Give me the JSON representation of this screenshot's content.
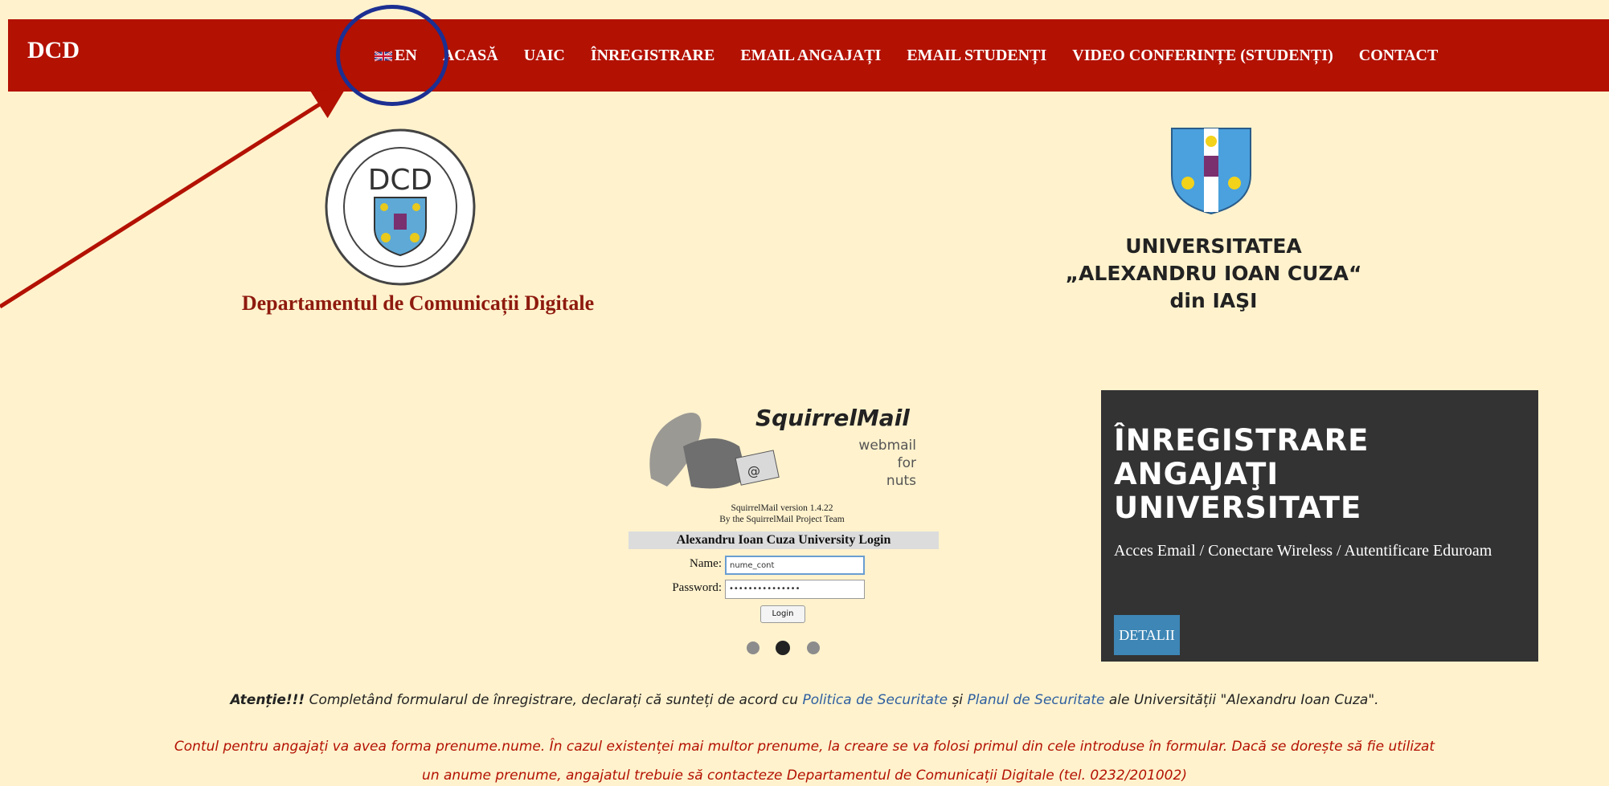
{
  "nav": {
    "brand": "DCD",
    "items": [
      {
        "label": "EN",
        "flag": "uk-flag-icon"
      },
      {
        "label": "ACASĂ"
      },
      {
        "label": "UAIC"
      },
      {
        "label": "ÎNREGISTRARE"
      },
      {
        "label": "EMAIL ANGAJAȚI"
      },
      {
        "label": "EMAIL STUDENȚI"
      },
      {
        "label": "VIDEO CONFERINȚE (STUDENȚI)"
      },
      {
        "label": "CONTACT"
      }
    ]
  },
  "dept": {
    "seal_text": "DCD",
    "name": "Departamentul de Comunicații Digitale"
  },
  "university": {
    "line1": "UNIVERSITATEA",
    "line2": "„ALEXANDRU IOAN CUZA“",
    "line3": "din IAŞI"
  },
  "squirrelmail": {
    "logo_title": "SquirrelMail",
    "logo_sub1": "webmail",
    "logo_sub2": "for",
    "logo_sub3": "nuts",
    "version": "SquirrelMail version 1.4.22",
    "team": "By the SquirrelMail Project Team",
    "login_title": "Alexandru Ioan Cuza University Login",
    "name_label": "Name:",
    "name_value": "nume_cont",
    "password_label": "Password:",
    "password_value": "•••••••••••••••",
    "login_button": "Login"
  },
  "carousel": {
    "count": 3,
    "active": 2
  },
  "registration": {
    "title_line1": "ÎNREGISTRARE",
    "title_line2": "ANGAJAŢI",
    "title_line3": "UNIVERSITATE",
    "description": "Acces Email / Conectare Wireless / Autentificare Eduroam",
    "button": "DETALII"
  },
  "notice": {
    "bold": "Atenție!!!",
    "text1": " Completând formularul de înregistrare, declarați că sunteți de acord cu ",
    "link1": "Politica de Securitate",
    "text2": " și ",
    "link2": "Planul de Securitate",
    "text3": " ale Universității \"Alexandru Ioan Cuza\"."
  },
  "warning": {
    "line1": "Contul pentru angajați va avea forma prenume.nume. În cazul existenței mai multor prenume, la creare se va folosi primul din cele introduse în formular. Dacă se dorește să fie utilizat",
    "line2": "un anume prenume, angajatul trebuie să contacteze Departamentul de Comunicații Digitale (tel. 0232/201002)"
  },
  "colors": {
    "background": "#fff2cd",
    "navbar": "#b31102",
    "annotation_circle": "#1c2f92",
    "annotation_arrow": "#b31102",
    "reg_box": "#333333",
    "button": "#3d86b5"
  }
}
